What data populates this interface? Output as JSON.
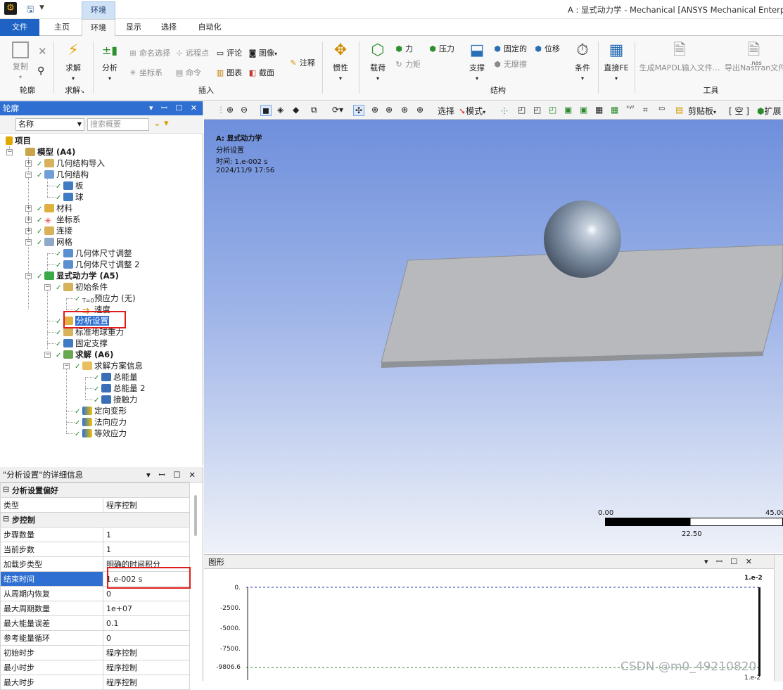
{
  "window": {
    "title": "A : 显式动力学 - Mechanical [ANSYS Mechanical Enterprise]"
  },
  "quick_access": {
    "save_icon": "save-icon",
    "dropdown_icon": "chevron-down-icon"
  },
  "context_tab": "环境",
  "tabs": [
    "文件",
    "主页",
    "环境",
    "显示",
    "选择",
    "自动化"
  ],
  "ribbon": {
    "outline_group": {
      "copy": "复制",
      "label": "轮廓"
    },
    "solve_group": {
      "solve": "求解",
      "label": "求解"
    },
    "insert_group": {
      "analysis": "分析",
      "named_sel": "命名选择",
      "remote_pt": "远程点",
      "comment": "评论",
      "image": "图像",
      "coord": "坐标系",
      "command": "命令",
      "chart": "图表",
      "section": "截面",
      "annotation": "注释",
      "label": "插入"
    },
    "inertia": "惯性",
    "structure_group": {
      "loads": "载荷",
      "force": "力",
      "pressure": "压力",
      "moment": "力矩",
      "supports": "支撑",
      "fixed": "固定的",
      "displacement": "位移",
      "frictionless": "无摩擦",
      "conditions": "条件",
      "direct_fe": "直接FE",
      "label": "结构"
    },
    "tools_group": {
      "mapdl": "生成MAPDL输入文件...",
      "nastran": "导出Nastran文件",
      "nas_badge": ".nas",
      "label": "工具"
    }
  },
  "outline": {
    "title": "轮廓",
    "filter_name": "名称",
    "search_placeholder": "搜索概要",
    "tree": {
      "project": "项目",
      "model": "模型 (A4)",
      "geom_import": "几何结构导入",
      "geometry": "几何结构",
      "plate": "板",
      "ball": "球",
      "materials": "材料",
      "coords": "坐标系",
      "connections": "连接",
      "mesh": "网格",
      "sizing1": "几何体尺寸调整",
      "sizing2": "几何体尺寸调整 2",
      "explicit": "显式动力学 (A5)",
      "init_cond": "初始条件",
      "prestress": "预应力 (无)",
      "velocity": "速度",
      "analysis_settings": "分析设置",
      "gravity": "标准地球重力",
      "fixed_support": "固定支撑",
      "solution": "求解 (A6)",
      "solution_info": "求解方案信息",
      "total_energy": "总能量",
      "total_energy2": "总能量 2",
      "contact_force": "接触力",
      "dir_deform": "定向变形",
      "normal_stress": "法向应力",
      "equiv_stress": "等效应力"
    }
  },
  "details": {
    "title": "\"分析设置\"的详细信息",
    "rows": [
      {
        "k": "分析设置偏好",
        "v": "",
        "section": true
      },
      {
        "k": "类型",
        "v": "程序控制"
      },
      {
        "k": "步控制",
        "v": "",
        "section": true
      },
      {
        "k": "步骤数量",
        "v": "1"
      },
      {
        "k": "当前步数",
        "v": "1"
      },
      {
        "k": "加载步类型",
        "v": "明确的时间积分"
      },
      {
        "k": "结束时间",
        "v": "1.e-002 s",
        "highlight": true
      },
      {
        "k": "从周期内恢复",
        "v": "0"
      },
      {
        "k": "最大周期数量",
        "v": "1e+07"
      },
      {
        "k": "最大能量误差",
        "v": "0.1"
      },
      {
        "k": "参考能量循环",
        "v": "0"
      },
      {
        "k": "初始时步",
        "v": "程序控制"
      },
      {
        "k": "最小时步",
        "v": "程序控制"
      },
      {
        "k": "最大时步",
        "v": "程序控制"
      }
    ]
  },
  "graphics_toolbar": {
    "select": "选择",
    "mode": "模式",
    "clipboard": "剪贴板",
    "empty": "[ 空 ]",
    "expand": "扩展"
  },
  "viewport": {
    "title": "A: 显式动力学",
    "subtitle": "分析设置",
    "time": "时间: 1.e-002 s",
    "date": "2024/11/9 17:56",
    "scale": {
      "min": "0.00",
      "mid": "22.50",
      "max": "45.00"
    }
  },
  "graph": {
    "title": "图形",
    "top_label": "1.e-2",
    "bottom_label": "1.e-2",
    "yticks": [
      "0.",
      "-2500.",
      "-5000.",
      "-7500.",
      "-9806.6"
    ]
  },
  "watermark": "CSDN @m0_49210820",
  "colors": {
    "accent": "#2e6fd1",
    "file_tab": "#1e63c4",
    "highlight_box": "#e01b1b"
  }
}
